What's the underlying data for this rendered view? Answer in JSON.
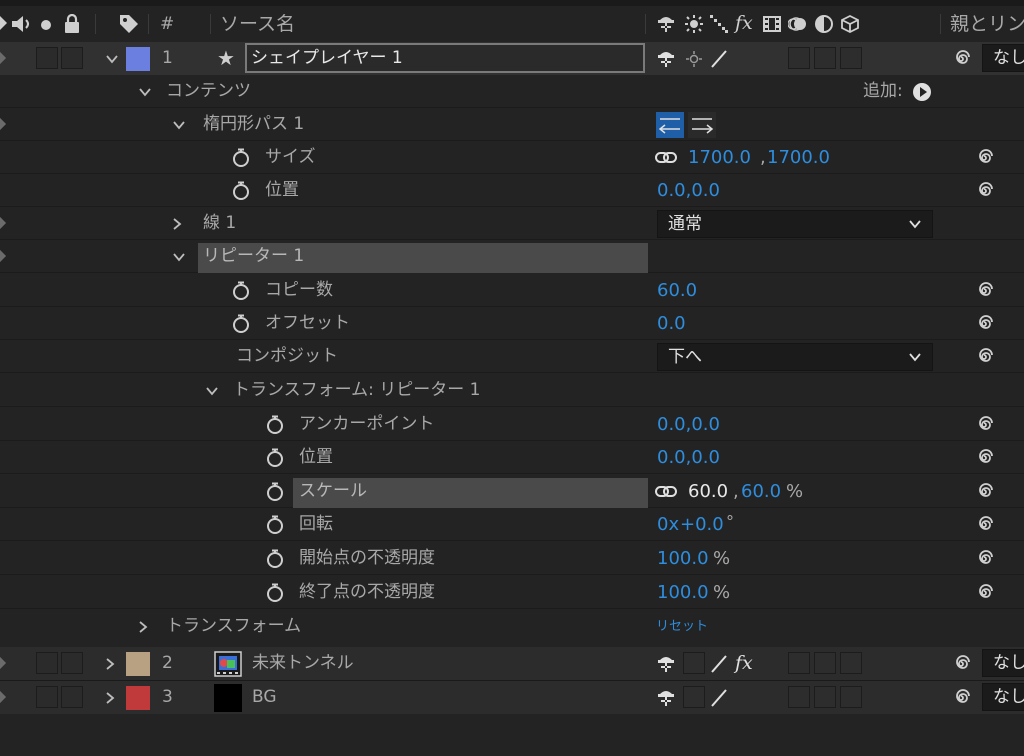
{
  "header": {
    "hash": "#",
    "source_name": "ソース名",
    "parent_link": "親とリン"
  },
  "layers": [
    {
      "num": "1",
      "name": "シェイプレイヤー 1",
      "color": "#6a7fe0",
      "parent": "なし"
    },
    {
      "num": "2",
      "name": "未来トンネル",
      "color": "#b8a082",
      "parent": "なし"
    },
    {
      "num": "3",
      "name": "BG",
      "color": "#c0393b",
      "parent": "なし"
    }
  ],
  "contents": {
    "label": "コンテンツ",
    "add_label": "追加:"
  },
  "ellipse": {
    "label": "楕円形パス 1",
    "size_label": "サイズ",
    "size_value_a": "1700.0",
    "size_sep": ",",
    "size_value_b": "1700.0",
    "position_label": "位置",
    "position_value": "0.0,0.0"
  },
  "stroke": {
    "label": "線 1",
    "blend_mode": "通常"
  },
  "repeater": {
    "label": "リピーター 1",
    "copies_label": "コピー数",
    "copies_value": "60.0",
    "offset_label": "オフセット",
    "offset_value": "0.0",
    "composite_label": "コンポジット",
    "composite_value": "下へ"
  },
  "repeater_transform": {
    "label": "トランスフォーム: リピーター 1",
    "anchor_label": "アンカーポイント",
    "anchor_value": "0.0,0.0",
    "position_label": "位置",
    "position_value": "0.0,0.0",
    "scale_label": "スケール",
    "scale_value_a": "60.0",
    "scale_sep": ",",
    "scale_value_b": "60.0",
    "scale_unit": "%",
    "rotation_label": "回転",
    "rotation_prefix": "0x",
    "rotation_value": "+0.0",
    "rotation_unit": "°",
    "start_opacity_label": "開始点の不透明度",
    "start_opacity_value": "100.0",
    "start_opacity_unit": "%",
    "end_opacity_label": "終了点の不透明度",
    "end_opacity_value": "100.0",
    "end_opacity_unit": "%"
  },
  "layer_transform": {
    "label": "トランスフォーム",
    "reset_label": "リセット"
  }
}
